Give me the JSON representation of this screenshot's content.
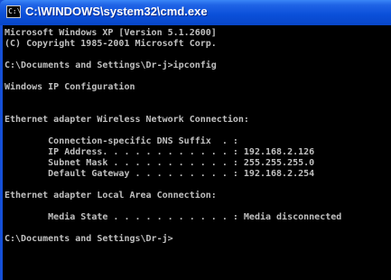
{
  "window": {
    "title": "C:\\WINDOWS\\system32\\cmd.exe",
    "icon": "cmd-icon",
    "icon_text": "C:\\"
  },
  "console": {
    "lines": [
      "Microsoft Windows XP [Version 5.1.2600]",
      "(C) Copyright 1985-2001 Microsoft Corp.",
      "",
      "C:\\Documents and Settings\\Dr-j>ipconfig",
      "",
      "Windows IP Configuration",
      "",
      "",
      "Ethernet adapter Wireless Network Connection:",
      "",
      "        Connection-specific DNS Suffix  . :",
      "        IP Address. . . . . . . . . . . . : 192.168.2.126",
      "        Subnet Mask . . . . . . . . . . . : 255.255.255.0",
      "        Default Gateway . . . . . . . . . : 192.168.2.254",
      "",
      "Ethernet adapter Local Area Connection:",
      "",
      "        Media State . . . . . . . . . . . : Media disconnected",
      "",
      "C:\\Documents and Settings\\Dr-j>"
    ]
  }
}
